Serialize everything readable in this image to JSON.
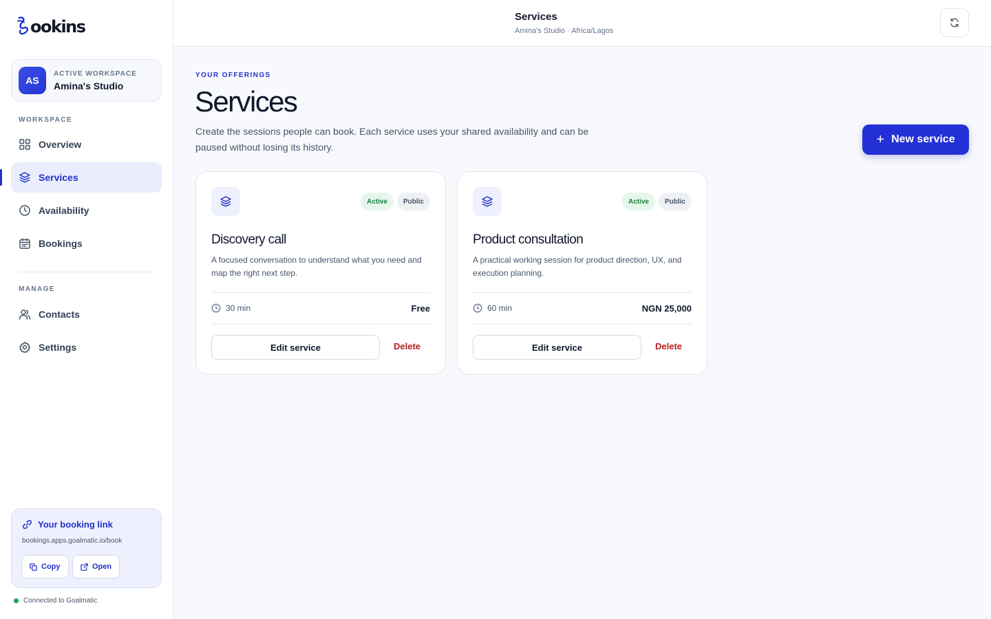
{
  "app": {
    "logo_text": "ookins"
  },
  "workspace": {
    "avatar_initials": "AS",
    "label": "ACTIVE WORKSPACE",
    "name": "Amina's Studio"
  },
  "sidebar": {
    "section_workspace": "WORKSPACE",
    "section_manage": "MANAGE",
    "items": [
      {
        "label": "Overview",
        "icon": "grid-icon"
      },
      {
        "label": "Services",
        "icon": "layers-icon",
        "active": true
      },
      {
        "label": "Availability",
        "icon": "clock-icon"
      },
      {
        "label": "Bookings",
        "icon": "calendar-icon"
      },
      {
        "label": "Contacts",
        "icon": "users-icon"
      },
      {
        "label": "Settings",
        "icon": "gear-icon"
      }
    ]
  },
  "booking_link": {
    "title": "Your booking link",
    "url": "bookings.apps.goalmatic.io/book",
    "copy_label": "Copy",
    "open_label": "Open"
  },
  "connection_status": "Connected to Goalmatic",
  "header": {
    "title": "Services",
    "subtitle": "Amina's Studio · Africa/Lagos"
  },
  "main": {
    "eyebrow": "YOUR OFFERINGS",
    "title": "Services",
    "description": "Create the sessions people can book. Each service uses your shared availability and can be paused without losing its history.",
    "new_button_label": "New service"
  },
  "services": [
    {
      "name": "Discovery call",
      "description": "A focused conversation to understand what you need and map the right next step.",
      "status_badge": "Active",
      "visibility_badge": "Public",
      "duration": "30 min",
      "price": "Free",
      "edit_label": "Edit service",
      "delete_label": "Delete"
    },
    {
      "name": "Product consultation",
      "description": "A practical working session for product direction, UX, and execution planning.",
      "status_badge": "Active",
      "visibility_badge": "Public",
      "duration": "60 min",
      "price": "NGN 25,000",
      "edit_label": "Edit service",
      "delete_label": "Delete"
    }
  ],
  "colors": {
    "accent": "#2330d6",
    "active_badge": "#15803d",
    "danger": "#b91c1c",
    "status_ok": "#16a34a"
  }
}
